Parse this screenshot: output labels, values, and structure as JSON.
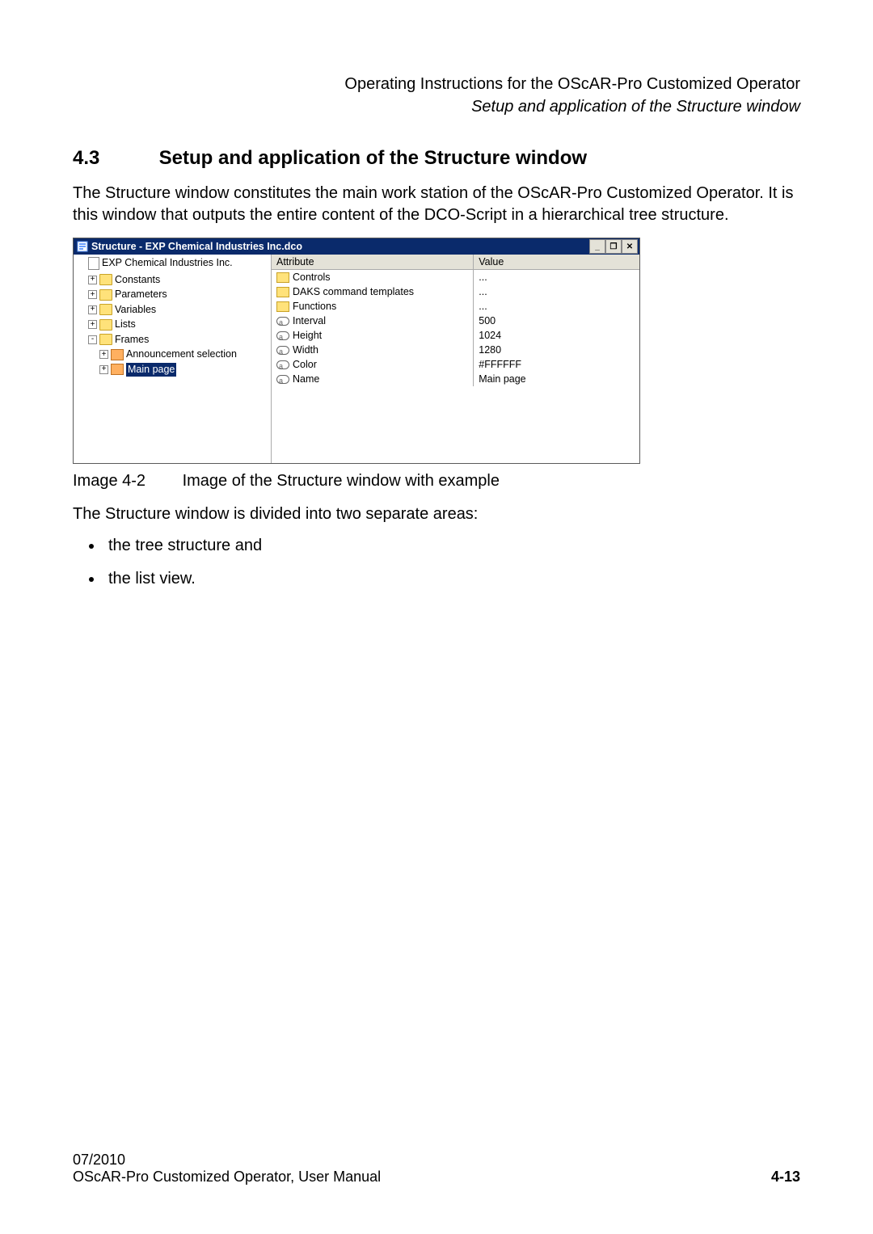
{
  "header": {
    "line1": "Operating Instructions for the OScAR-Pro Customized Operator",
    "line2": "Setup and application of the Structure window"
  },
  "section": {
    "number": "4.3",
    "title": "Setup and application of the Structure window"
  },
  "intro_paragraph": "The Structure window constitutes the main work station of the OScAR-Pro Customized Operator. It is this window that outputs the entire content of the DCO-Script in a hierarchical tree structure.",
  "window": {
    "title": "Structure - EXP Chemical Industries Inc.dco",
    "tree": {
      "root_label": "EXP Chemical Industries Inc.",
      "items": [
        {
          "label": "Constants",
          "expander": "+"
        },
        {
          "label": "Parameters",
          "expander": "+"
        },
        {
          "label": "Variables",
          "expander": "+"
        },
        {
          "label": "Lists",
          "expander": "+"
        },
        {
          "label": "Frames",
          "expander": "-"
        }
      ],
      "frames_children": [
        {
          "label": "Announcement selection",
          "expander": "+"
        },
        {
          "label": "Main page",
          "expander": "+",
          "selected": true
        }
      ]
    },
    "list": {
      "headers": {
        "attribute": "Attribute",
        "value": "Value"
      },
      "rows": [
        {
          "icon": "folder",
          "attribute": "Controls",
          "value": "..."
        },
        {
          "icon": "folder",
          "attribute": "DAKS command templates",
          "value": "..."
        },
        {
          "icon": "folder",
          "attribute": "Functions",
          "value": "..."
        },
        {
          "icon": "attr",
          "attribute": "Interval",
          "value": "500"
        },
        {
          "icon": "attr",
          "attribute": "Height",
          "value": "1024"
        },
        {
          "icon": "attr",
          "attribute": "Width",
          "value": "1280"
        },
        {
          "icon": "attr",
          "attribute": "Color",
          "value": "#FFFFFF"
        },
        {
          "icon": "attr",
          "attribute": "Name",
          "value": "Main page"
        }
      ]
    }
  },
  "caption": {
    "label": "Image 4-2",
    "text": "Image of the Structure window with example"
  },
  "after_caption": "The Structure window is divided into two separate areas:",
  "bullets": [
    "the tree structure and",
    "the list view."
  ],
  "footer": {
    "date": "07/2010",
    "doc": "OScAR-Pro Customized Operator, User Manual",
    "page": "4-13"
  }
}
